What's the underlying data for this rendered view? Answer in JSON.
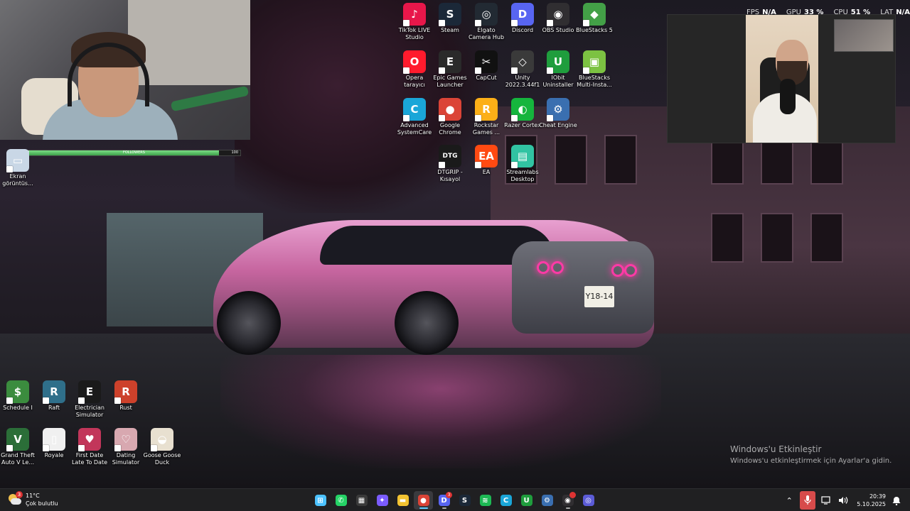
{
  "perf": {
    "fps_label": "FPS",
    "fps_value": "N/A",
    "gpu_label": "GPU",
    "gpu_value": "33 %",
    "cpu_label": "CPU",
    "cpu_value": "51 %",
    "lat_label": "LAT",
    "lat_value": "N/A"
  },
  "progress": {
    "left": "0",
    "middle": "FOLLOWERS",
    "right": "100",
    "fraction": 0.9
  },
  "desktop_icons_top": [
    {
      "label": "TikTok LIVE\nStudio",
      "icon": "tiktok-live-icon",
      "glyph": "♪",
      "color": "#e8174a"
    },
    {
      "label": "Steam",
      "icon": "steam-icon",
      "glyph": "S",
      "color": "#1b2838"
    },
    {
      "label": "Elgato\nCamera Hub",
      "icon": "elgato-icon",
      "glyph": "◎",
      "color": "#222a33"
    },
    {
      "label": "Discord",
      "icon": "discord-icon",
      "glyph": "D",
      "color": "#5865f2"
    },
    {
      "label": "OBS Studio",
      "icon": "obs-icon",
      "glyph": "◉",
      "color": "#302e31"
    },
    {
      "label": "BlueStacks 5",
      "icon": "bluestacks-icon",
      "glyph": "◆",
      "color": "#43a047"
    },
    {
      "label": "Opera\ntarayıcı",
      "icon": "opera-icon",
      "glyph": "O",
      "color": "#ff1b2d"
    },
    {
      "label": "Epic Games\nLauncher",
      "icon": "epic-games-icon",
      "glyph": "E",
      "color": "#2a2a2a"
    },
    {
      "label": "CapCut",
      "icon": "capcut-icon",
      "glyph": "✂",
      "color": "#111111"
    },
    {
      "label": "Unity\n2022.3.44f1",
      "icon": "unity-icon",
      "glyph": "◇",
      "color": "#3a3a3a"
    },
    {
      "label": "IObit\nUninstaller",
      "icon": "iobit-icon",
      "glyph": "U",
      "color": "#1f9d3d"
    },
    {
      "label": "BlueStacks\nMulti-Insta...",
      "icon": "bluestacks-multi-icon",
      "glyph": "▣",
      "color": "#7cc242"
    },
    {
      "label": "Advanced\nSystemCare",
      "icon": "advanced-systemcare-icon",
      "glyph": "C",
      "color": "#1aa6d8"
    },
    {
      "label": "Google\nChrome",
      "icon": "chrome-icon",
      "glyph": "●",
      "color": "#db4437"
    },
    {
      "label": "Rockstar\nGames ...",
      "icon": "rockstar-icon",
      "glyph": "R",
      "color": "#fcaf17"
    },
    {
      "label": "Razer Cortex",
      "icon": "razer-cortex-icon",
      "glyph": "◐",
      "color": "#15b53d"
    },
    {
      "label": "Cheat Engine",
      "icon": "cheat-engine-icon",
      "glyph": "⚙",
      "color": "#3a6fb0"
    },
    {
      "label": "DTGRIP -\nKısayol",
      "icon": "dtgrip-icon",
      "glyph": "DTG",
      "color": "#1a1a1a"
    },
    {
      "label": "EA",
      "icon": "ea-icon",
      "glyph": "EA",
      "color": "#ff4a12"
    },
    {
      "label": "Streamlabs\nDesktop",
      "icon": "streamlabs-icon",
      "glyph": "▤",
      "color": "#31c3a2"
    }
  ],
  "desktop_icons_left": [
    {
      "label": "Ekran\ngörüntüs...",
      "icon": "screenshot-file-icon",
      "glyph": "▭",
      "color": "#c9d7e6"
    },
    {
      "label": "Schedule I",
      "icon": "schedule-i-icon",
      "glyph": "$",
      "color": "#3b8c3e"
    },
    {
      "label": "Raft",
      "icon": "raft-icon",
      "glyph": "R",
      "color": "#2f6f8a"
    },
    {
      "label": "Electrician\nSimulator",
      "icon": "electrician-simulator-icon",
      "glyph": "E",
      "color": "#1a1a1a"
    },
    {
      "label": "Rust",
      "icon": "rust-icon",
      "glyph": "R",
      "color": "#cd412b"
    },
    {
      "label": "Grand Theft\nAuto V Le...",
      "icon": "gta-v-icon",
      "glyph": "V",
      "color": "#2b6e38"
    },
    {
      "label": "Royale",
      "icon": "royale-file-icon",
      "glyph": "▯",
      "color": "#f0f0f0"
    },
    {
      "label": "First Date\nLate To Date",
      "icon": "first-date-icon",
      "glyph": "♥",
      "color": "#c2365a"
    },
    {
      "label": "Dating\nSimulator",
      "icon": "dating-simulator-icon",
      "glyph": "♡",
      "color": "#d8a8b0"
    },
    {
      "label": "Goose Goose\nDuck",
      "icon": "goose-goose-duck-icon",
      "glyph": "◒",
      "color": "#e8e0d0"
    }
  ],
  "activation": {
    "title": "Windows'u Etkinleştir",
    "subtitle": "Windows'u etkinleştirmek için Ayarlar'a gidin."
  },
  "weather": {
    "temp": "11°C",
    "condition": "Çok bulutlu",
    "badge": "3"
  },
  "taskbar_apps": [
    {
      "name": "start-button",
      "glyph": "⊞",
      "color": "#4cc2ff",
      "active": false
    },
    {
      "name": "whatsapp-taskbar-icon",
      "glyph": "✆",
      "color": "#25d366",
      "active": false
    },
    {
      "name": "microsoft-store-taskbar-icon",
      "glyph": "▦",
      "color": "#3a3a3a",
      "active": false
    },
    {
      "name": "copilot-taskbar-icon",
      "glyph": "✦",
      "color": "#7b5cff",
      "active": false
    },
    {
      "name": "file-explorer-taskbar-icon",
      "glyph": "▬",
      "color": "#f3c331",
      "active": false
    },
    {
      "name": "chrome-taskbar-icon",
      "glyph": "●",
      "color": "#db4437",
      "active": true
    },
    {
      "name": "discord-taskbar-icon",
      "glyph": "D",
      "color": "#5865f2",
      "active": false,
      "badge": "3"
    },
    {
      "name": "steam-taskbar-icon",
      "glyph": "S",
      "color": "#1b2838",
      "active": false
    },
    {
      "name": "spotify-taskbar-icon",
      "glyph": "≋",
      "color": "#1db954",
      "active": false
    },
    {
      "name": "advanced-systemcare-taskbar-icon",
      "glyph": "C",
      "color": "#1aa6d8",
      "active": false
    },
    {
      "name": "iobit-taskbar-icon",
      "glyph": "U",
      "color": "#1f9d3d",
      "active": false
    },
    {
      "name": "cheat-engine-taskbar-icon",
      "glyph": "⚙",
      "color": "#3a6fb0",
      "active": false
    },
    {
      "name": "obs-taskbar-icon",
      "glyph": "◉",
      "color": "#302e31",
      "active": false,
      "badge": " "
    },
    {
      "name": "app-taskbar-icon",
      "glyph": "◎",
      "color": "#5b5bd6",
      "active": false
    }
  ],
  "tray": {
    "time": "20:39",
    "date": "5.10.2025"
  }
}
